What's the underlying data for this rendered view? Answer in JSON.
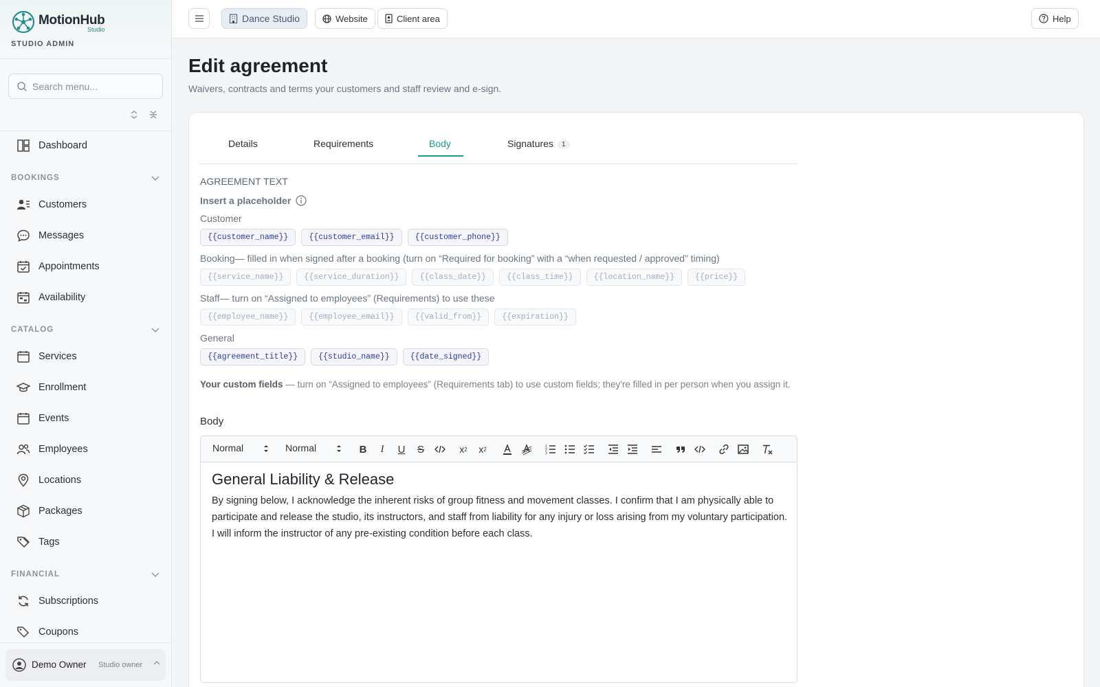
{
  "brand": {
    "name": "MotionHub",
    "sub": "Studio",
    "role": "STUDIO ADMIN"
  },
  "search": {
    "placeholder": "Search menu..."
  },
  "nav": {
    "dashboard": "Dashboard",
    "bookings_section": "BOOKINGS",
    "customers": "Customers",
    "messages": "Messages",
    "appointments": "Appointments",
    "availability": "Availability",
    "catalog_section": "CATALOG",
    "services": "Services",
    "enrollment": "Enrollment",
    "events": "Events",
    "employees": "Employees",
    "locations": "Locations",
    "packages": "Packages",
    "tags": "Tags",
    "financial_section": "FINANCIAL",
    "subscriptions": "Subscriptions",
    "coupons": "Coupons"
  },
  "user": {
    "name": "Demo Owner",
    "role": "Studio owner"
  },
  "topbar": {
    "studio": "Dance Studio",
    "website": "Website",
    "client_area": "Client area",
    "help": "Help"
  },
  "page": {
    "title": "Edit agreement",
    "subtitle": "Waivers, contracts and terms your customers and staff review and e-sign."
  },
  "tabs": {
    "details": "Details",
    "requirements": "Requirements",
    "body": "Body",
    "signatures": "Signatures",
    "signatures_count": "1"
  },
  "agreement": {
    "section_label": "AGREEMENT TEXT",
    "insert_label": "Insert a placeholder",
    "customer_head": "Customer",
    "customer_chips": [
      "{{customer_name}}",
      "{{customer_email}}",
      "{{customer_phone}}"
    ],
    "booking_head": "Booking— filled in when signed after a booking (turn on “Required for booking” with a “when requested / approved” timing)",
    "booking_chips": [
      "{{service_name}}",
      "{{service_duration}}",
      "{{class_date}}",
      "{{class_time}}",
      "{{location_name}}",
      "{{price}}"
    ],
    "staff_head": "Staff— turn on “Assigned to employees” (Requirements) to use these",
    "staff_chips": [
      "{{employee_name}}",
      "{{employee_email}}",
      "{{valid_from}}",
      "{{expiration}}"
    ],
    "general_head": "General",
    "general_chips": [
      "{{agreement_title}}",
      "{{studio_name}}",
      "{{date_signed}}"
    ],
    "custom_bold": "Your custom fields",
    "custom_rest": " — turn on “Assigned to employees” (Requirements tab) to use custom fields; they're filled in per person when you assign it.",
    "body_label": "Body"
  },
  "editor": {
    "heading_select": "Normal",
    "size_select": "Normal",
    "doc_title": "General Liability & Release",
    "para1": "By signing below, I acknowledge the inherent risks of group fitness and movement classes. I confirm that I am physically able to participate and release the studio, its instructors, and staff from liability for any injury or loss arising from my voluntary participation.",
    "para2": "I will inform the instructor of any pre-existing condition before each class."
  }
}
